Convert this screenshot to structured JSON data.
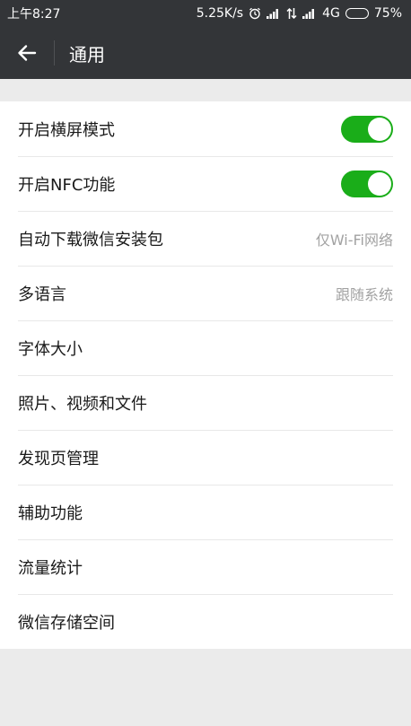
{
  "status_bar": {
    "time": "上午8:27",
    "net_speed": "5.25K/s",
    "network": "4G",
    "battery": "75%",
    "battery_level": 0.75
  },
  "header": {
    "title": "通用"
  },
  "colors": {
    "header_bg": "#333538",
    "toggle_on": "#1aad19",
    "page_bg": "#ebebeb"
  },
  "settings": [
    {
      "label": "开启横屏模式",
      "type": "toggle",
      "on": true
    },
    {
      "label": "开启NFC功能",
      "type": "toggle",
      "on": true
    },
    {
      "label": "自动下载微信安装包",
      "type": "value",
      "value": "仅Wi-Fi网络"
    },
    {
      "label": "多语言",
      "type": "value",
      "value": "跟随系统"
    },
    {
      "label": "字体大小",
      "type": "link"
    },
    {
      "label": "照片、视频和文件",
      "type": "link"
    },
    {
      "label": "发现页管理",
      "type": "link"
    },
    {
      "label": "辅助功能",
      "type": "link"
    },
    {
      "label": "流量统计",
      "type": "link"
    },
    {
      "label": "微信存储空间",
      "type": "link"
    }
  ]
}
